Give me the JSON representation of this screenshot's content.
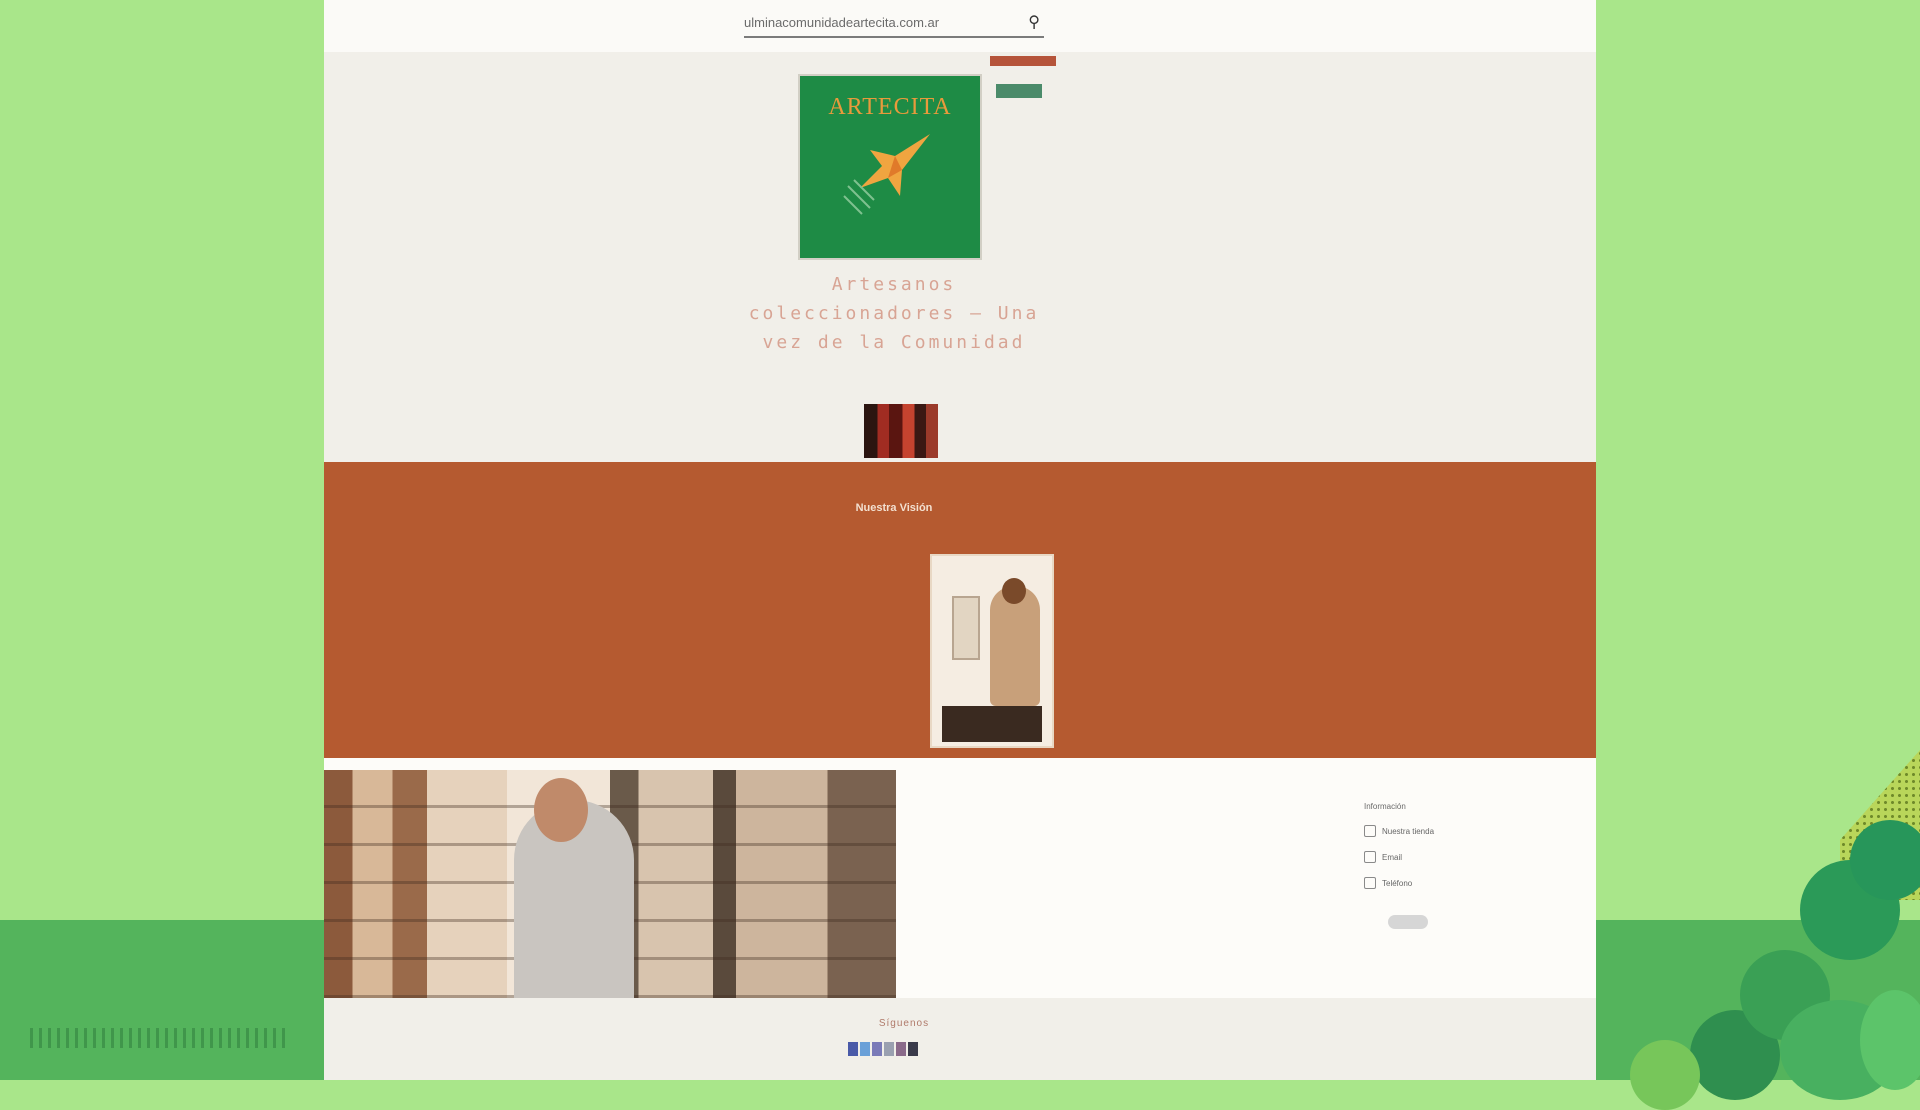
{
  "browser": {
    "url": "ulminacomunidadeartecita.com.ar"
  },
  "header": {
    "logo_text": "ARTECITA",
    "hero_title": "Artesanos coleccionadores — Una vez de la Comunidad",
    "hero_sub": "",
    "hero_desc": "",
    "top_button_1": "",
    "top_button_2": ""
  },
  "about": {
    "heading": "Nuestra Visión",
    "body": ""
  },
  "sidebar": {
    "heading": "Información",
    "items": [
      {
        "label": "Nuestra tienda",
        "sub": "",
        "icon": "location-icon"
      },
      {
        "label": "Email",
        "sub": "",
        "icon": "mail-icon"
      },
      {
        "label": "Teléfono",
        "sub": "",
        "icon": "phone-icon"
      }
    ]
  },
  "footer": {
    "heading": "Síguenos",
    "social": [
      "facebook-icon",
      "twitter-icon",
      "instagram-icon",
      "youtube-icon",
      "pinterest-icon",
      "linkedin-icon"
    ]
  },
  "colors": {
    "brand_green": "#1e8b45",
    "brand_orange": "#b55a30",
    "page_background": "#a9e68a"
  }
}
